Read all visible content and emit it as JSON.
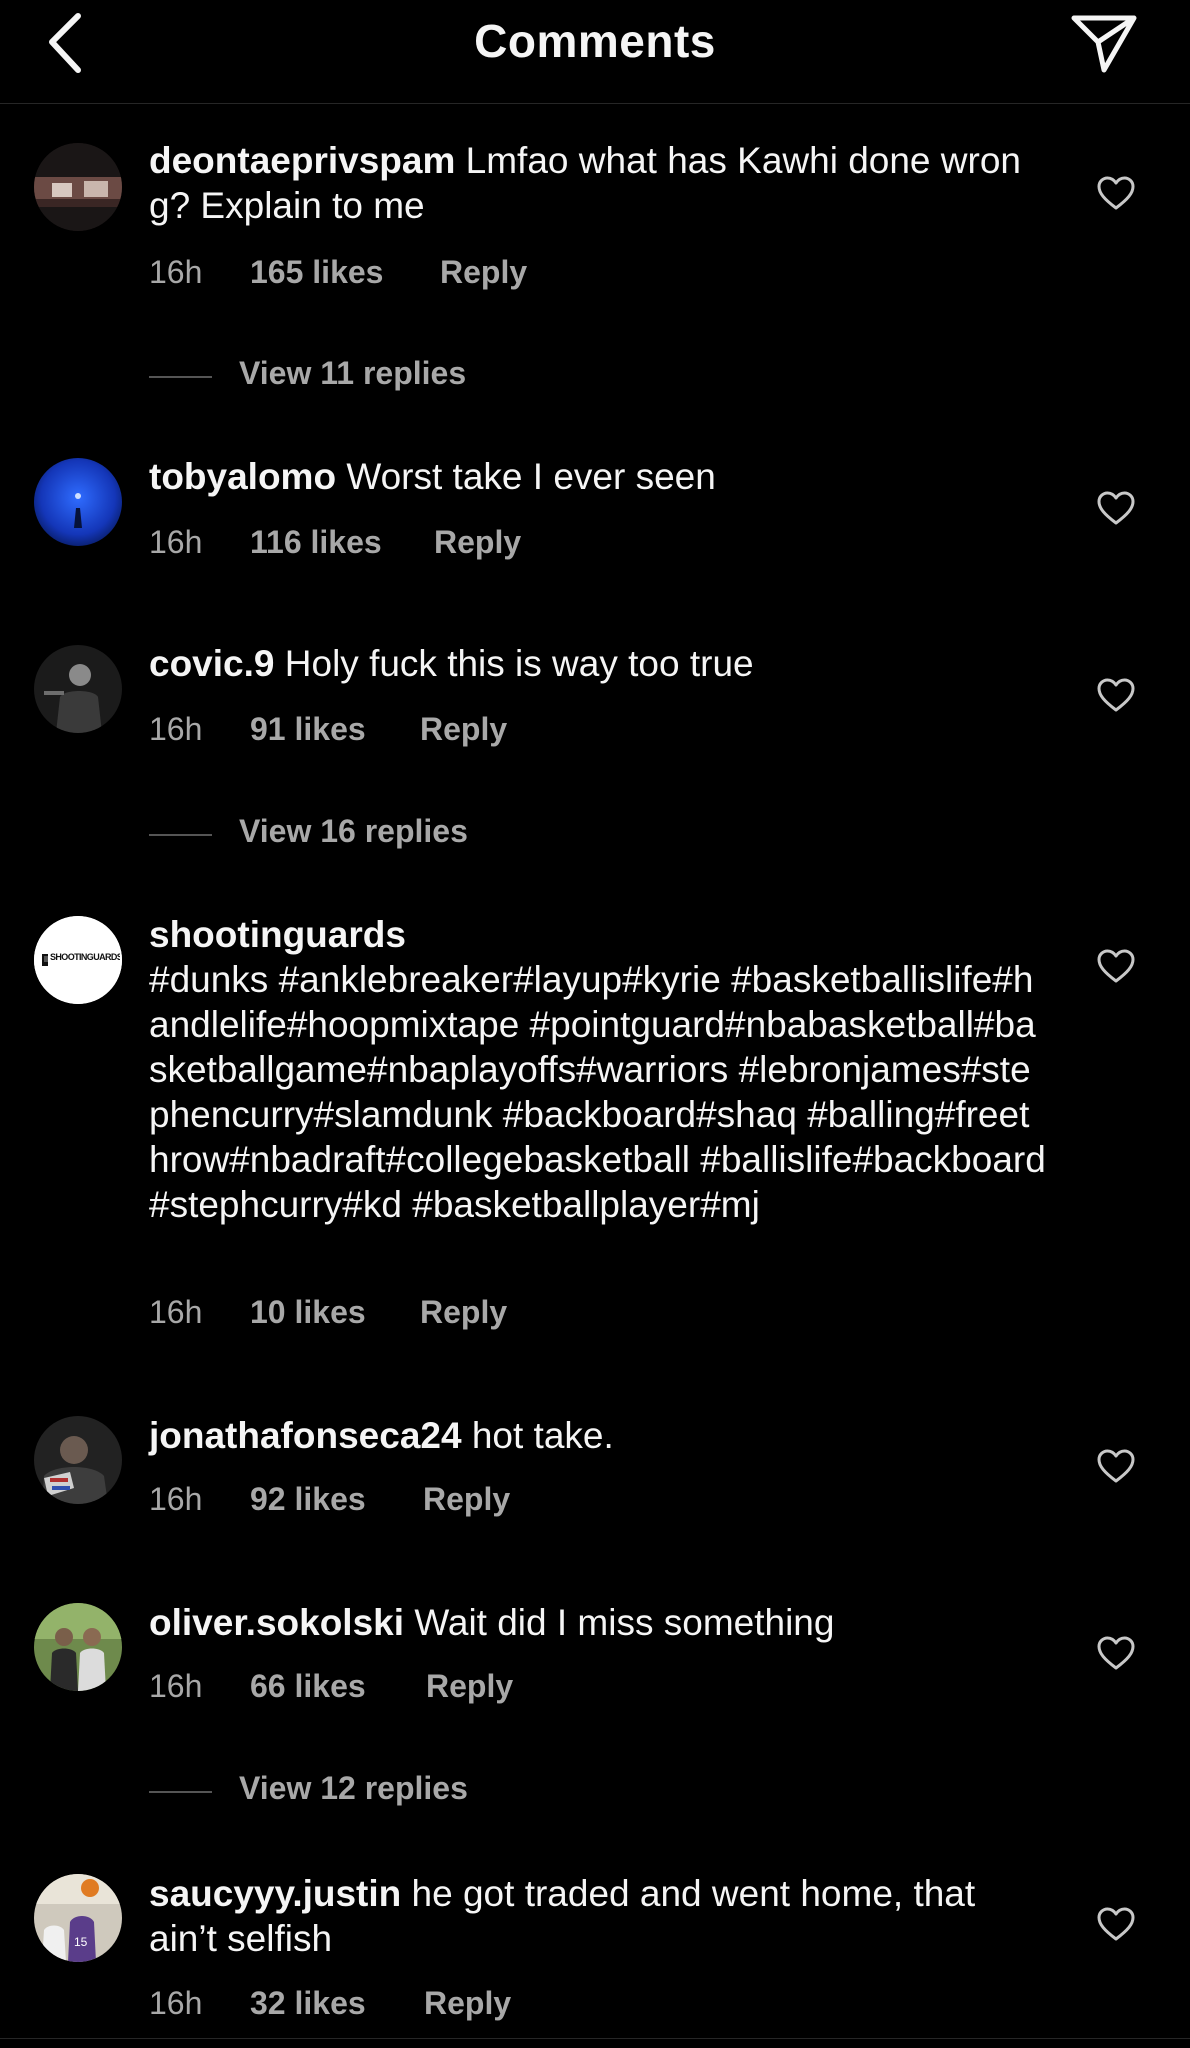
{
  "header": {
    "title": "Comments",
    "back_icon": "chevron-left-icon",
    "share_icon": "paper-plane-icon"
  },
  "colors": {
    "background": "#000000",
    "text_primary": "#f5f5f5",
    "text_secondary": "#a8a8a8"
  },
  "comments": [
    {
      "username": "deontaeprivspam",
      "text": "Lmfao what has Kawhi done wrong? Explain to me",
      "time": "16h",
      "likes": "165 likes",
      "reply": "Reply",
      "view_replies": "View 11 replies"
    },
    {
      "username": "tobyalomo",
      "text": "Worst take I ever seen",
      "time": "16h",
      "likes": "116 likes",
      "reply": "Reply"
    },
    {
      "username": "covic.9",
      "text": "Holy fuck this is way too true",
      "time": "16h",
      "likes": "91 likes",
      "reply": "Reply",
      "view_replies": "View 16 replies"
    },
    {
      "username": "shootinguards",
      "text": "#dunks #anklebreaker#layup#kyrie #basketballislife#handlelife#hoopmixtape #pointguard#nbabasketball#basketballgame#nbaplayoffs#warriors #lebronjames#stephencurry#slamdunk #backboard#shaq #balling#freethrow#nbadraft#collegebasketball #ballislife#backboard#stephcurry#kd #basketballplayer#mj",
      "time": "16h",
      "likes": "10 likes",
      "reply": "Reply",
      "avatar_text": "SHOOTINGUARDS"
    },
    {
      "username": "jonathafonseca24",
      "text": "hot take.",
      "time": "16h",
      "likes": "92 likes",
      "reply": "Reply"
    },
    {
      "username": "oliver.sokolski",
      "text": "Wait did I miss something",
      "time": "16h",
      "likes": "66 likes",
      "reply": "Reply",
      "view_replies": "View 12 replies"
    },
    {
      "username": "saucyyy.justin",
      "text": "he got traded and went home, that ain’t selfish",
      "time": "16h",
      "likes": "32 likes",
      "reply": "Reply"
    }
  ]
}
